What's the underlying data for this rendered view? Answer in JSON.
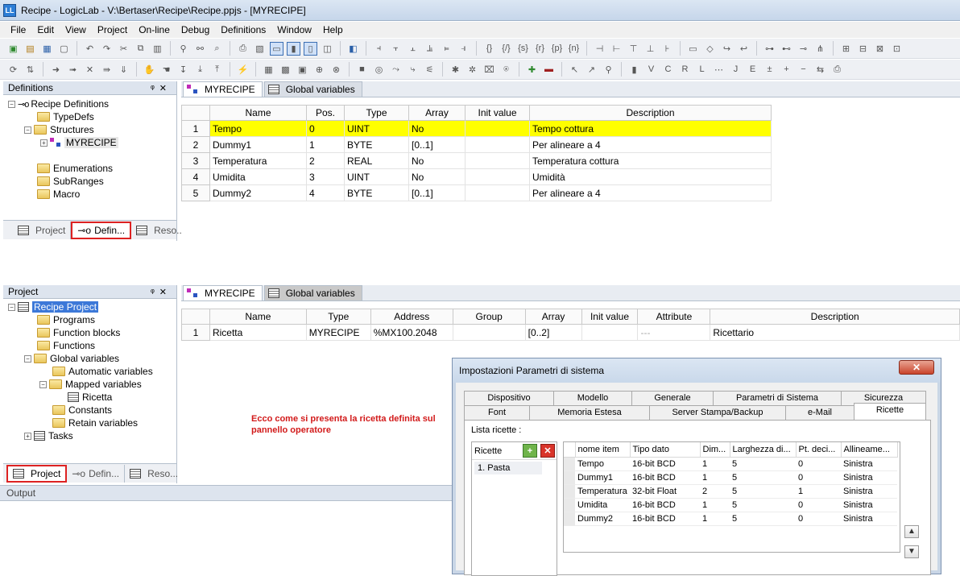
{
  "window": {
    "title": "Recipe - LogicLab - V:\\Bertaser\\Recipe\\Recipe.ppjs - [MYRECIPE]"
  },
  "menu": [
    "File",
    "Edit",
    "View",
    "Project",
    "On-line",
    "Debug",
    "Definitions",
    "Window",
    "Help"
  ],
  "def_panel": {
    "title": "Definitions",
    "tree": {
      "root": "Recipe Definitions",
      "typedefs": "TypeDefs",
      "structures": "Structures",
      "myrecipe": "MYRECIPE",
      "enumerations": "Enumerations",
      "subranges": "SubRanges",
      "macro": "Macro"
    },
    "tabs": {
      "project": "Project",
      "defin": "Defin...",
      "reso": "Reso..."
    }
  },
  "top_doc": {
    "tabs": {
      "myrecipe": "MYRECIPE",
      "globals": "Global variables"
    },
    "headers": [
      "",
      "Name",
      "Pos.",
      "Type",
      "Array",
      "Init value",
      "Description"
    ],
    "rows": [
      {
        "n": "1",
        "name": "Tempo",
        "pos": "0",
        "type": "UINT",
        "array": "No",
        "init": "",
        "desc": "Tempo cottura"
      },
      {
        "n": "2",
        "name": "Dummy1",
        "pos": "1",
        "type": "BYTE",
        "array": "[0..1]",
        "init": "",
        "desc": "Per alineare a 4"
      },
      {
        "n": "3",
        "name": "Temperatura",
        "pos": "2",
        "type": "REAL",
        "array": "No",
        "init": "",
        "desc": "Temperatura cottura"
      },
      {
        "n": "4",
        "name": "Umidita",
        "pos": "3",
        "type": "UINT",
        "array": "No",
        "init": "",
        "desc": "Umidità"
      },
      {
        "n": "5",
        "name": "Dummy2",
        "pos": "4",
        "type": "BYTE",
        "array": "[0..1]",
        "init": "",
        "desc": "Per alineare a 4"
      }
    ]
  },
  "proj_panel": {
    "title": "Project",
    "tree": {
      "root": "Recipe Project",
      "programs": "Programs",
      "fblocks": "Function blocks",
      "functions": "Functions",
      "globals": "Global variables",
      "automatic": "Automatic variables",
      "mapped": "Mapped variables",
      "ricetta": "Ricetta",
      "constants": "Constants",
      "retain": "Retain variables",
      "tasks": "Tasks"
    },
    "tabs": {
      "project": "Project",
      "defin": "Defin...",
      "reso": "Reso..."
    }
  },
  "bottom_doc": {
    "tabs": {
      "myrecipe": "MYRECIPE",
      "globals": "Global variables"
    },
    "headers": [
      "",
      "Name",
      "Type",
      "Address",
      "Group",
      "Array",
      "Init value",
      "Attribute",
      "Description"
    ],
    "rows": [
      {
        "n": "1",
        "name": "Ricetta",
        "type": "MYRECIPE",
        "address": "%MX100.2048",
        "group": "",
        "array": "[0..2]",
        "init": "",
        "attribute": "---",
        "desc": "Ricettario"
      }
    ]
  },
  "note": "Ecco come si presenta la ricetta definita sul pannello operatore",
  "output": {
    "title": "Output"
  },
  "dialog": {
    "title": "Impostazioni Parametri di sistema",
    "tabs_row1": [
      "Dispositivo",
      "Modello",
      "Generale",
      "Parametri di Sistema",
      "Sicurezza"
    ],
    "tabs_row2": [
      "Font",
      "Memoria Estesa",
      "Server Stampa/Backup",
      "e-Mail",
      "Ricette"
    ],
    "lista_label": "Lista ricette :",
    "ricette_header": "Ricette",
    "ricette_items": [
      "1. Pasta"
    ],
    "columns": [
      "nome item",
      "Tipo dato",
      "Dim...",
      "Larghezza di...",
      "Pt. deci...",
      "Allineame..."
    ],
    "rows": [
      {
        "name": "Tempo",
        "tipo": "16-bit BCD",
        "dim": "1",
        "larg": "5",
        "pt": "0",
        "all": "Sinistra"
      },
      {
        "name": "Dummy1",
        "tipo": "16-bit BCD",
        "dim": "1",
        "larg": "5",
        "pt": "0",
        "all": "Sinistra"
      },
      {
        "name": "Temperatura",
        "tipo": "32-bit Float",
        "dim": "2",
        "larg": "5",
        "pt": "1",
        "all": "Sinistra"
      },
      {
        "name": "Umidita",
        "tipo": "16-bit BCD",
        "dim": "1",
        "larg": "5",
        "pt": "0",
        "all": "Sinistra"
      },
      {
        "name": "Dummy2",
        "tipo": "16-bit BCD",
        "dim": "1",
        "larg": "5",
        "pt": "0",
        "all": "Sinistra"
      }
    ]
  }
}
